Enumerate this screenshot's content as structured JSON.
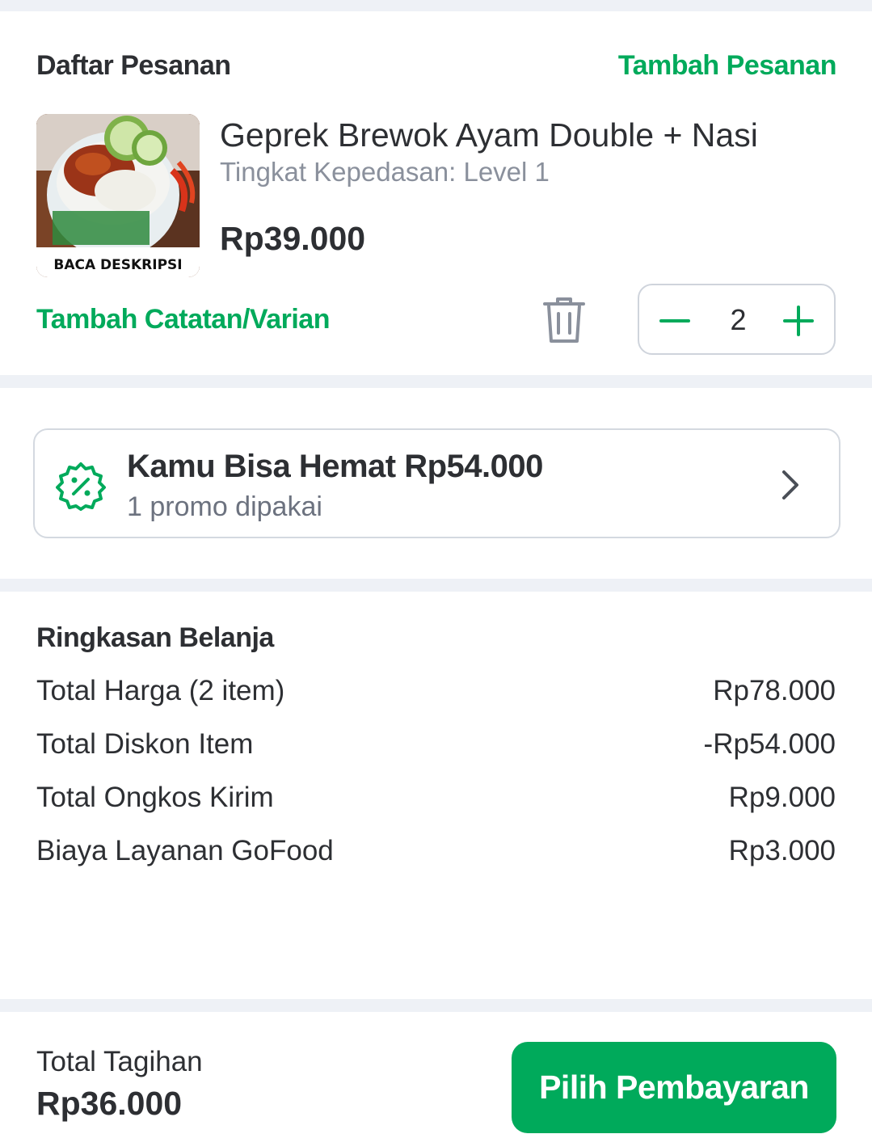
{
  "order": {
    "section_title": "Daftar Pesanan",
    "add_order_link": "Tambah Pesanan",
    "item": {
      "image_caption": "BACA DESKRIPSI",
      "name": "Geprek Brewok Ayam Double + Nasi",
      "variant": "Tingkat Kepedasan: Level 1",
      "price": "Rp39.000",
      "add_note_link": "Tambah Catatan/Varian",
      "quantity": "2"
    }
  },
  "promo": {
    "title": "Kamu Bisa Hemat Rp54.000",
    "subtitle": "1 promo dipakai",
    "icon": "discount-badge-icon",
    "accent_color": "#00aa5b"
  },
  "summary": {
    "title": "Ringkasan Belanja",
    "rows": [
      {
        "label": "Total Harga (2 item)",
        "value": "Rp78.000"
      },
      {
        "label": "Total Diskon Item",
        "value": "-Rp54.000"
      },
      {
        "label": "Total Ongkos Kirim",
        "value": "Rp9.000"
      },
      {
        "label": "Biaya Layanan GoFood",
        "value": "Rp3.000"
      }
    ]
  },
  "footer": {
    "total_label": "Total Tagihan",
    "total_value": "Rp36.000",
    "pay_button": "Pilih Pembayaran"
  },
  "colors": {
    "brand_green": "#00aa5b",
    "text_dark": "#2d2f33",
    "text_muted": "#8a909c",
    "divider": "#eef1f6"
  }
}
